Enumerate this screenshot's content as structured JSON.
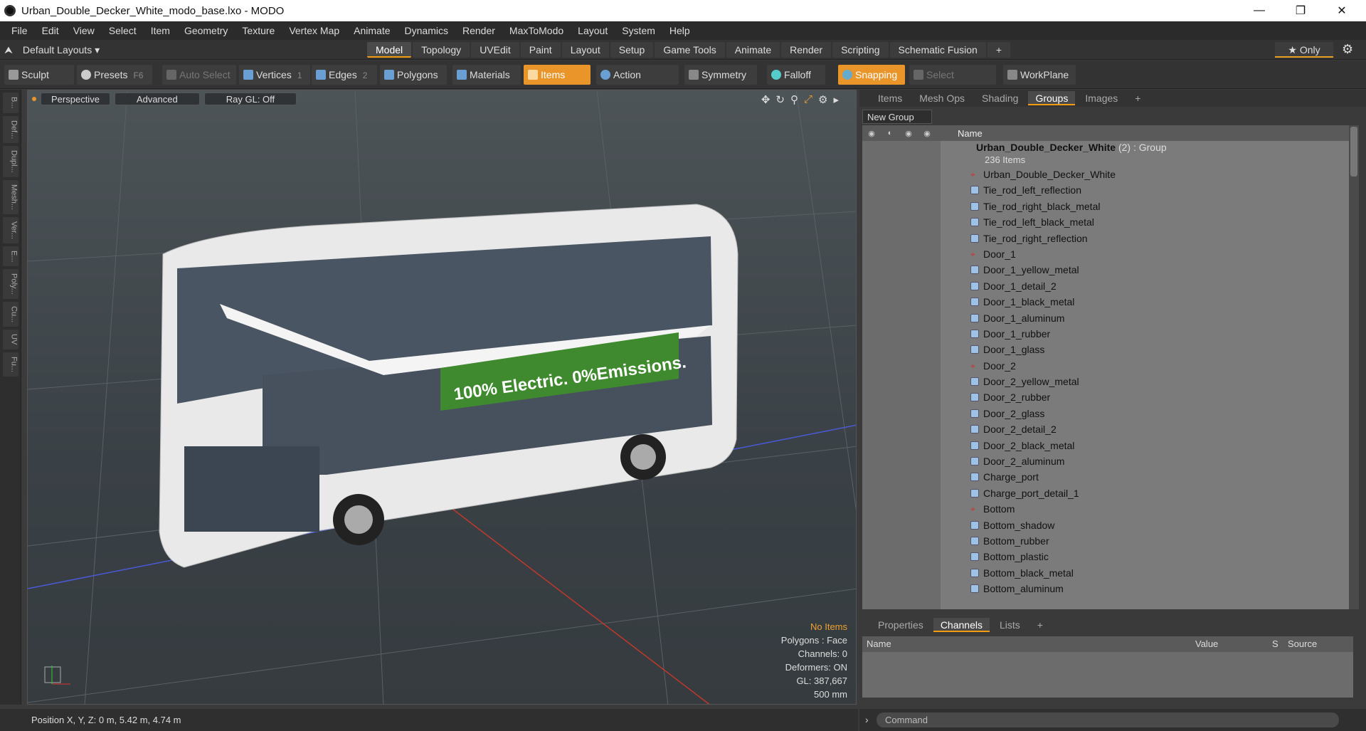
{
  "window": {
    "title": "Urban_Double_Decker_White_modo_base.lxo - MODO"
  },
  "menu": [
    "File",
    "Edit",
    "View",
    "Select",
    "Item",
    "Geometry",
    "Texture",
    "Vertex Map",
    "Animate",
    "Dynamics",
    "Render",
    "MaxToModo",
    "Layout",
    "System",
    "Help"
  ],
  "layout": {
    "selector": "Default Layouts ▾",
    "only": "★ Only"
  },
  "tabs": [
    "Model",
    "Topology",
    "UVEdit",
    "Paint",
    "Layout",
    "Setup",
    "Game Tools",
    "Animate",
    "Render",
    "Scripting",
    "Schematic Fusion",
    "+"
  ],
  "toolbar": {
    "sculpt": "Sculpt",
    "presets": "Presets",
    "presets_key": "F6",
    "auto_select": "Auto Select",
    "vertices": "Vertices",
    "vertices_key": "1",
    "edges": "Edges",
    "edges_key": "2",
    "polygons": "Polygons",
    "materials": "Materials",
    "items": "Items",
    "action_center": "Action Center",
    "symmetry": "Symmetry",
    "falloff": "Falloff",
    "snapping": "Snapping",
    "select_through": "Select Through",
    "workplane": "WorkPlane"
  },
  "left_tools": [
    "B...",
    "Def...",
    "Dupl...",
    "Mesh...",
    "Ver...",
    "E...",
    "Poly...",
    "Cu...",
    "UV",
    "Fu..."
  ],
  "viewport": {
    "view": "Perspective",
    "advanced": "Advanced",
    "raygl": "Ray GL: Off",
    "banner": "100% Electric. 0%Emissions.",
    "info": {
      "items": "No Items",
      "polygons": "Polygons : Face",
      "channels": "Channels: 0",
      "deformers": "Deformers: ON",
      "gl": "GL: 387,667",
      "size": "500 mm"
    }
  },
  "status": {
    "position": "Position X, Y, Z:   0 m, 5.42 m, 4.74 m"
  },
  "right_tabs": [
    "Items",
    "Mesh Ops",
    "Shading",
    "Groups",
    "Images",
    "+"
  ],
  "new_group": "New Group",
  "tree": {
    "header": "Name",
    "root_name": "Urban_Double_Decker_White",
    "root_count": "(2)",
    "root_type": ": Group",
    "root_sub": "236 Items",
    "items": [
      {
        "name": "Urban_Double_Decker_White",
        "icon": "locator"
      },
      {
        "name": "Tie_rod_left_reflection",
        "icon": "mesh"
      },
      {
        "name": "Tie_rod_right_black_metal",
        "icon": "mesh"
      },
      {
        "name": "Tie_rod_left_black_metal",
        "icon": "mesh"
      },
      {
        "name": "Tie_rod_right_reflection",
        "icon": "mesh"
      },
      {
        "name": "Door_1",
        "icon": "locator"
      },
      {
        "name": "Door_1_yellow_metal",
        "icon": "mesh"
      },
      {
        "name": "Door_1_detail_2",
        "icon": "mesh"
      },
      {
        "name": "Door_1_black_metal",
        "icon": "mesh"
      },
      {
        "name": "Door_1_aluminum",
        "icon": "mesh"
      },
      {
        "name": "Door_1_rubber",
        "icon": "mesh"
      },
      {
        "name": "Door_1_glass",
        "icon": "mesh"
      },
      {
        "name": "Door_2",
        "icon": "locator"
      },
      {
        "name": "Door_2_yellow_metal",
        "icon": "mesh"
      },
      {
        "name": "Door_2_rubber",
        "icon": "mesh"
      },
      {
        "name": "Door_2_glass",
        "icon": "mesh"
      },
      {
        "name": "Door_2_detail_2",
        "icon": "mesh"
      },
      {
        "name": "Door_2_black_metal",
        "icon": "mesh"
      },
      {
        "name": "Door_2_aluminum",
        "icon": "mesh"
      },
      {
        "name": "Charge_port",
        "icon": "mesh"
      },
      {
        "name": "Charge_port_detail_1",
        "icon": "mesh"
      },
      {
        "name": "Bottom",
        "icon": "locator"
      },
      {
        "name": "Bottom_shadow",
        "icon": "mesh"
      },
      {
        "name": "Bottom_rubber",
        "icon": "mesh"
      },
      {
        "name": "Bottom_plastic",
        "icon": "mesh"
      },
      {
        "name": "Bottom_black_metal",
        "icon": "mesh"
      },
      {
        "name": "Bottom_aluminum",
        "icon": "mesh"
      }
    ]
  },
  "bottom_tabs": [
    "Properties",
    "Channels",
    "Lists",
    "+"
  ],
  "channels": {
    "name": "Name",
    "value": "Value",
    "s": "S",
    "source": "Source"
  },
  "command": {
    "placeholder": "Command"
  }
}
